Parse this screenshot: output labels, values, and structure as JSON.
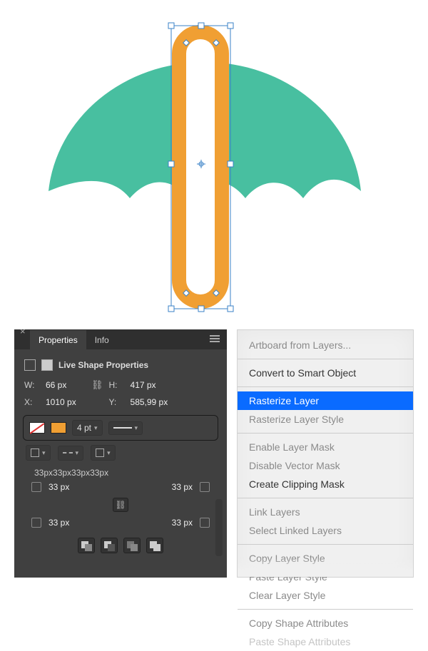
{
  "chart_data": null,
  "canvas": {
    "umbrella_color": "#48bfa0",
    "stick_stroke": "#f09f33",
    "stick_fill": "#ffffff"
  },
  "panel": {
    "tabs": {
      "properties": "Properties",
      "info": "Info"
    },
    "section_title": "Live Shape Properties",
    "dim": {
      "w_label": "W:",
      "w_value": "66 px",
      "h_label": "H:",
      "h_value": "417 px",
      "x_label": "X:",
      "x_value": "1010 px",
      "y_label": "Y:",
      "y_value": "585,99 px"
    },
    "stroke": {
      "weight": "4 pt"
    },
    "corners": {
      "summary": "33px33px33px33px",
      "tl": "33 px",
      "tr": "33 px",
      "bl": "33 px",
      "br": "33 px"
    }
  },
  "ctx": {
    "items": [
      {
        "label": "Artboard from Layers...",
        "state": "disabled"
      },
      {
        "label": "Convert to Smart Object",
        "state": "enabled"
      },
      {
        "label": "Rasterize Layer",
        "state": "selected"
      },
      {
        "label": "Rasterize Layer Style",
        "state": "disabled"
      },
      {
        "label": "Enable Layer Mask",
        "state": "disabled"
      },
      {
        "label": "Disable Vector Mask",
        "state": "disabled"
      },
      {
        "label": "Create Clipping Mask",
        "state": "enabled"
      },
      {
        "label": "Link Layers",
        "state": "disabled"
      },
      {
        "label": "Select Linked Layers",
        "state": "disabled"
      },
      {
        "label": "Copy Layer Style",
        "state": "disabled"
      },
      {
        "label": "Paste Layer Style",
        "state": "disabled"
      },
      {
        "label": "Clear Layer Style",
        "state": "disabled"
      },
      {
        "label": "Copy Shape Attributes",
        "state": "disabled"
      },
      {
        "label": "Paste Shape Attributes",
        "state": "disabled"
      }
    ]
  }
}
